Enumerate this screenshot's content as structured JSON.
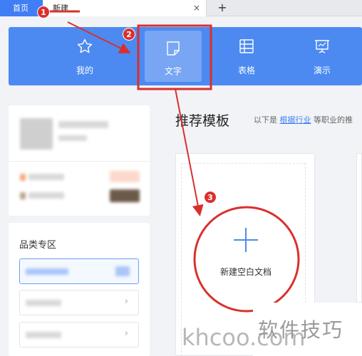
{
  "tabs": [
    {
      "label": "首页"
    },
    {
      "label": "新建",
      "close": "×"
    }
  ],
  "new_tab_plus": "+",
  "type_bar": [
    {
      "label": "我的",
      "icon": "star-icon"
    },
    {
      "label": "文字",
      "icon": "document-icon",
      "selected": true
    },
    {
      "label": "表格",
      "icon": "table-icon"
    },
    {
      "label": "演示",
      "icon": "presentation-icon"
    }
  ],
  "sidebar": {
    "category_title": "品类专区",
    "chevron": "›"
  },
  "main": {
    "section_title": "推荐模板",
    "subtitle_pre": "以下是",
    "subtitle_link": "根据行业",
    "subtitle_post": "等职业的推",
    "blank_label": "新建空白文档"
  },
  "annotations": [
    "1",
    "2",
    "3"
  ],
  "watermark": {
    "en": "khcoo.com",
    "cn": "软件技巧"
  },
  "colors": {
    "accent": "#4c8af1",
    "annotation": "#d9302e",
    "selected_bg": "#78a6f5"
  }
}
